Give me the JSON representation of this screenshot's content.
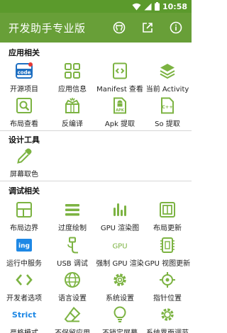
{
  "status_bar": {
    "time": "10:58"
  },
  "app_bar": {
    "title": "开发助手专业版"
  },
  "sections": {
    "app": {
      "title": "应用相关",
      "items": [
        {
          "label": "开源项目",
          "icon": "code-icon",
          "badge_text": "code"
        },
        {
          "label": "应用信息",
          "icon": "grid-icon"
        },
        {
          "label": "Manifest 查看",
          "icon": "manifest-icon"
        },
        {
          "label": "当前 Activity",
          "icon": "layers-icon"
        },
        {
          "label": "布局查看",
          "icon": "layout-inspect-icon"
        },
        {
          "label": "反编译",
          "icon": "decompile-box-icon"
        },
        {
          "label": "Apk 提取",
          "icon": "apk-file-icon",
          "file_text": "APK"
        },
        {
          "label": "So 提取",
          "icon": "so-file-icon",
          "file_text": "C++"
        }
      ]
    },
    "design": {
      "title": "设计工具",
      "items": [
        {
          "label": "屏幕取色",
          "icon": "eyedropper-icon"
        }
      ]
    },
    "debug": {
      "title": "调试相关",
      "items": [
        {
          "label": "布局边界",
          "icon": "layout-bounds-icon"
        },
        {
          "label": "过度绘制",
          "icon": "overdraw-icon"
        },
        {
          "label": "GPU 渲染图",
          "icon": "gpu-bars-icon"
        },
        {
          "label": "布局更新",
          "icon": "layout-update-icon"
        },
        {
          "label": "运行中服务",
          "icon": "running-services-icon",
          "icon_text": "ing"
        },
        {
          "label": "USB 调试",
          "icon": "usb-icon"
        },
        {
          "label": "强制 GPU 渲染",
          "icon": "force-gpu-icon",
          "icon_text": "GPU"
        },
        {
          "label": "GPU 视图更新",
          "icon": "gpu-view-update-icon"
        },
        {
          "label": "开发者选项",
          "icon": "developer-options-icon"
        },
        {
          "label": "语言设置",
          "icon": "language-icon"
        },
        {
          "label": "系统设置",
          "icon": "system-settings-icon"
        },
        {
          "label": "指针位置",
          "icon": "pointer-location-icon"
        },
        {
          "label": "严格模式",
          "icon": "strict-mode-icon",
          "icon_text": "Strict"
        },
        {
          "label": "不保留应用",
          "icon": "eraser-icon"
        },
        {
          "label": "不锁定屏幕",
          "icon": "bulb-icon"
        },
        {
          "label": "系统界面调节",
          "icon": "system-ui-tuner-icon"
        }
      ]
    }
  },
  "colors": {
    "primary": "#689f38",
    "status_bar": "#5b9a2c",
    "icon_green": "#7cb342",
    "badge_red": "#e53935",
    "icon_blue": "#1e88e5"
  }
}
